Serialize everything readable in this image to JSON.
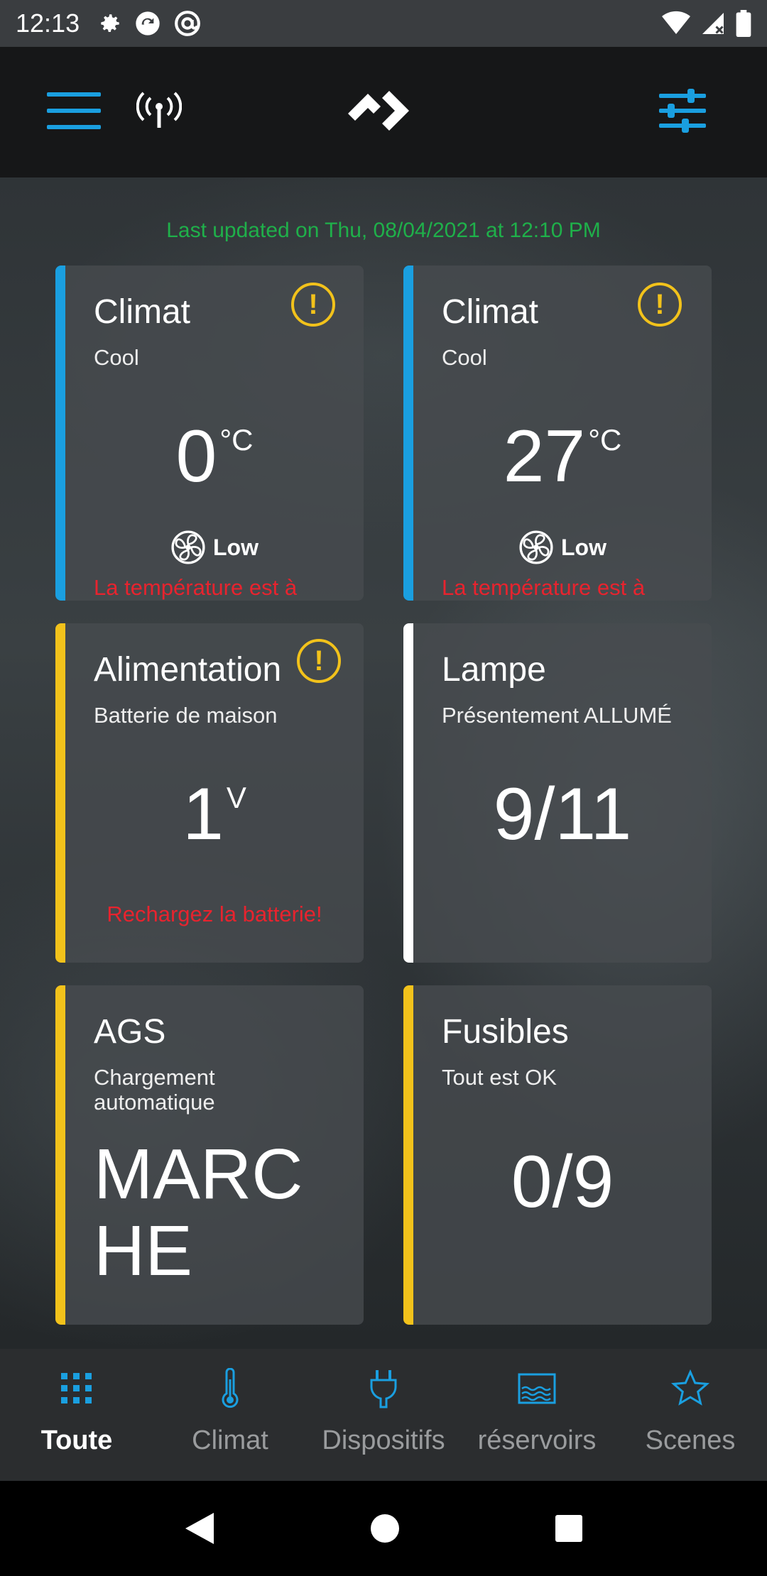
{
  "status": {
    "time": "12:13"
  },
  "header": {
    "logo": "app-logo"
  },
  "main": {
    "last_updated": "Last updated on Thu, 08/04/2021 at 12:10 PM",
    "cards": [
      {
        "title": "Climat",
        "subtitle": "Cool",
        "value": "0",
        "unit": "°C",
        "fan": "Low",
        "alert": "La température est à l’extérieur de la plage",
        "accent": "#1a9fe0"
      },
      {
        "title": "Climat",
        "subtitle": "Cool",
        "value": "27",
        "unit": "°C",
        "fan": "Low",
        "alert": "La température est à l’extérieur de la plage",
        "accent": "#1a9fe0"
      },
      {
        "title": "Alimentation",
        "subtitle": "Batterie de maison",
        "value": "1",
        "unit": "V",
        "alert": "Rechargez la batterie!",
        "accent": "#f2c21b"
      },
      {
        "title": "Lampe",
        "subtitle": "Présentement ALLUMÉ",
        "value": "9/11",
        "accent": "#ffffff"
      },
      {
        "title": "AGS",
        "subtitle": "Chargement automatique",
        "value_line1": "MARC",
        "value_line2": "HE",
        "accent": "#f2c21b"
      },
      {
        "title": "Fusibles",
        "subtitle": "Tout est OK",
        "value": "0/9",
        "accent": "#f2c21b"
      }
    ]
  },
  "bottom_nav": [
    {
      "label": "Toute",
      "icon": "grid-icon",
      "active": true
    },
    {
      "label": "Climat",
      "icon": "thermometer-icon"
    },
    {
      "label": "Dispositifs",
      "icon": "plug-icon"
    },
    {
      "label": "réservoirs",
      "icon": "tank-icon"
    },
    {
      "label": "Scenes",
      "icon": "star-icon"
    }
  ],
  "colors": {
    "accent_blue": "#1a9fe0",
    "warning_yellow": "#f2c21b",
    "alert_red": "#e8232e",
    "updated_green": "#1fb04a"
  }
}
